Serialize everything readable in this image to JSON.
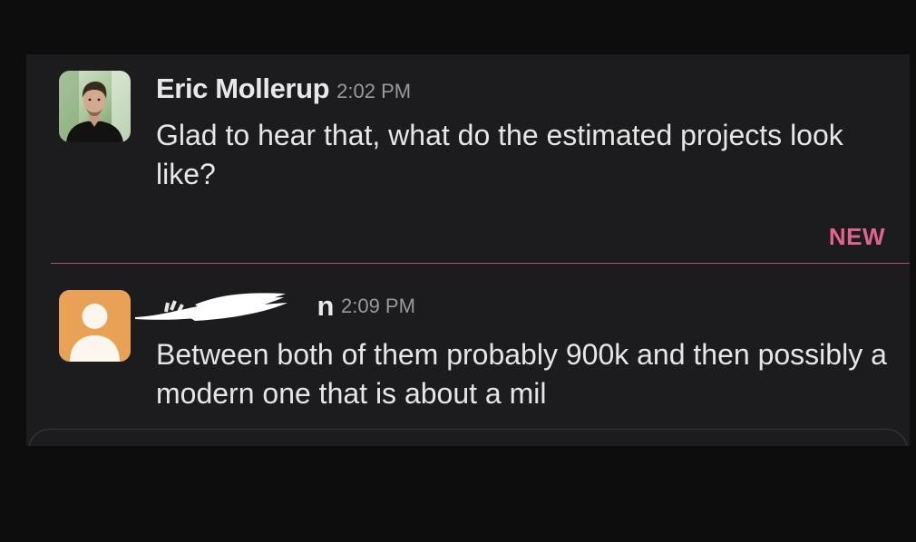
{
  "messages": [
    {
      "sender": "Eric Mollerup",
      "time": "2:02 PM",
      "text": "Glad to hear that, what do the estimated projects look like?",
      "avatar": "profile-photo"
    },
    {
      "sender": "n",
      "time": "2:09 PM",
      "text": "Between both of them probably 900k and then possibly a modern one that is about a mil",
      "avatar": "default-user-icon",
      "avatar_color": "#e9a156"
    }
  ],
  "divider": {
    "label": "NEW",
    "color": "#e0658c"
  },
  "colors": {
    "background": "#0d0d0d",
    "panel": "#1c1c1f",
    "text": "#e6e6e6",
    "muted": "#9a9a9d"
  }
}
